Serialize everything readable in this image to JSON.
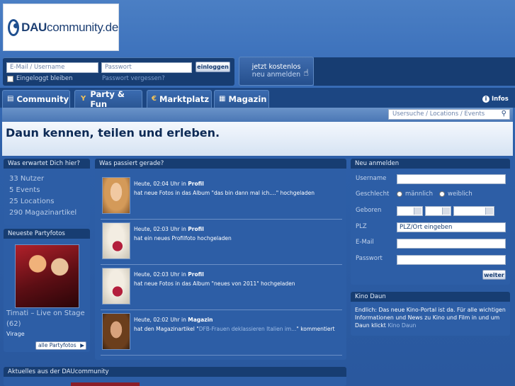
{
  "brand": {
    "prefix": "DAU",
    "suffix": "community.de"
  },
  "login": {
    "email_placeholder": "E-Mail / Username",
    "password_placeholder": "Passwort",
    "submit_label": "einloggen",
    "remember_label": "Eingeloggt bleiben",
    "forgot_label": "Passwort vergessen?"
  },
  "register_cta": {
    "line1": "jetzt kostenlos",
    "line2": "neu anmelden"
  },
  "tabs": [
    {
      "label": "Community",
      "icon": "community-icon"
    },
    {
      "label": "Party & Fun",
      "icon": "cocktail-icon"
    },
    {
      "label": "Marktplatz",
      "icon": "euro-icon"
    },
    {
      "label": "Magazin",
      "icon": "newspaper-icon"
    }
  ],
  "infos_label": "Infos",
  "search": {
    "placeholder": "Usersuche / Locations / Events"
  },
  "hero_title": "Daun kennen, teilen und erleben.",
  "expect": {
    "title": "Was erwartet Dich hier?",
    "stats": [
      "33 Nutzer",
      "5 Events",
      "25 Locations",
      "290 Magazinartikel"
    ]
  },
  "party": {
    "title": "Neueste Partyfotos",
    "caption": "Timati – Live on Stage",
    "count": "(62)",
    "venue": "Virage",
    "all_label": "alle Partyfotos"
  },
  "feed": {
    "title": "Was passiert gerade?",
    "items": [
      {
        "time": "Heute, 02:04 Uhr in",
        "section": "Profil",
        "text": "hat neue Fotos in das Album \"das bin dann mal ich....\" hochgeladen"
      },
      {
        "time": "Heute, 02:03 Uhr in",
        "section": "Profil",
        "text": "hat ein neues Profilfoto hochgeladen"
      },
      {
        "time": "Heute, 02:03 Uhr in",
        "section": "Profil",
        "text": "hat neue Fotos in das Album \"neues von 2011\" hochgeladen"
      },
      {
        "time": "Heute, 02:02 Uhr in",
        "section": "Magazin",
        "text_before": "hat den Magazinartikel \"",
        "link": "DFB-Frauen deklassieren Italien im...",
        "text_after": "\" kommentiert"
      }
    ]
  },
  "signup": {
    "title": "Neu anmelden",
    "username_label": "Username",
    "gender_label": "Geschlecht",
    "male_label": "männlich",
    "female_label": "weiblich",
    "born_label": "Geboren",
    "zip_label": "PLZ",
    "zip_value": "PLZ/Ort eingeben",
    "email_label": "E-Mail",
    "password_label": "Passwort",
    "submit_label": "weiter"
  },
  "kino": {
    "title": "Kino Daun",
    "text": "Endlich: Das neue Kino-Portal ist da. Für alle wichtigen Informationen und News zu Kino und Film in und um Daun klickt",
    "link": "Kino Daun"
  },
  "news": {
    "title": "Aktuelles aus der DAUcommunity"
  }
}
